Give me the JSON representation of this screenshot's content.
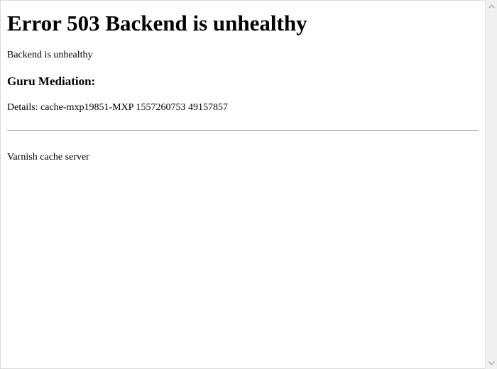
{
  "page": {
    "heading": "Error 503 Backend is unhealthy",
    "message": "Backend is unhealthy",
    "guru_heading": "Guru Mediation:",
    "details": "Details: cache-mxp19851-MXP 1557260753 49157857",
    "footer": "Varnish cache server"
  },
  "scrollbar": {
    "up_icon": "chevron-up-icon",
    "down_icon": "chevron-down-icon",
    "track_color": "#f0f0f0",
    "arrow_color": "#a6a6a6"
  }
}
